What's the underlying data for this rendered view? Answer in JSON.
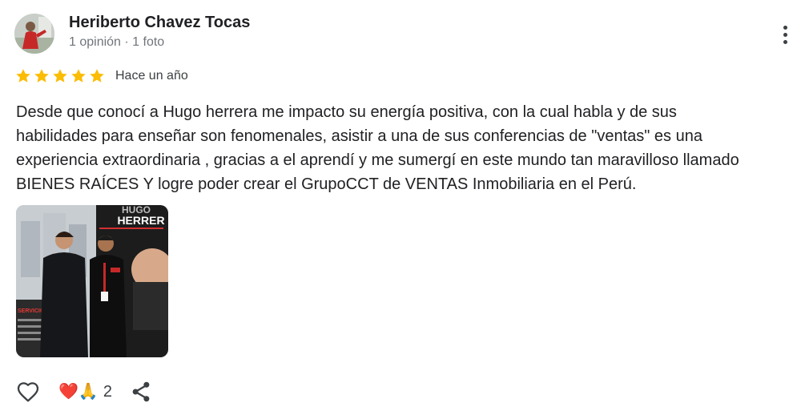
{
  "author": {
    "name": "Heriberto Chavez Tocas",
    "meta": "1 opinión · 1 foto"
  },
  "rating": {
    "stars": 5,
    "max_stars": 5,
    "date": "Hace un año",
    "star_color": "#fbbc04"
  },
  "review": {
    "text": "Desde que conocí a Hugo herrera me impacto su energía positiva, con la cual habla y de sus habilidades para enseñar son fenomenales, asistir a una de sus conferencias de \"ventas\" es una experiencia extraordinaria , gracias a el aprendí y me sumergí en este mundo tan maravilloso llamado BIENES RAÍCES Y logre poder crear el GrupoCCT de VENTAS Inmobiliaria en el Perú."
  },
  "photo": {
    "banner_line1": "HUGO",
    "banner_line2": "HERRER",
    "panel_text": "SERVICIOS"
  },
  "actions": {
    "reaction_emojis": "❤️🙏",
    "reaction_count": "2",
    "like_icon": "heart-outline-icon",
    "share_icon": "share-icon",
    "more_icon": "more-vertical-icon"
  }
}
